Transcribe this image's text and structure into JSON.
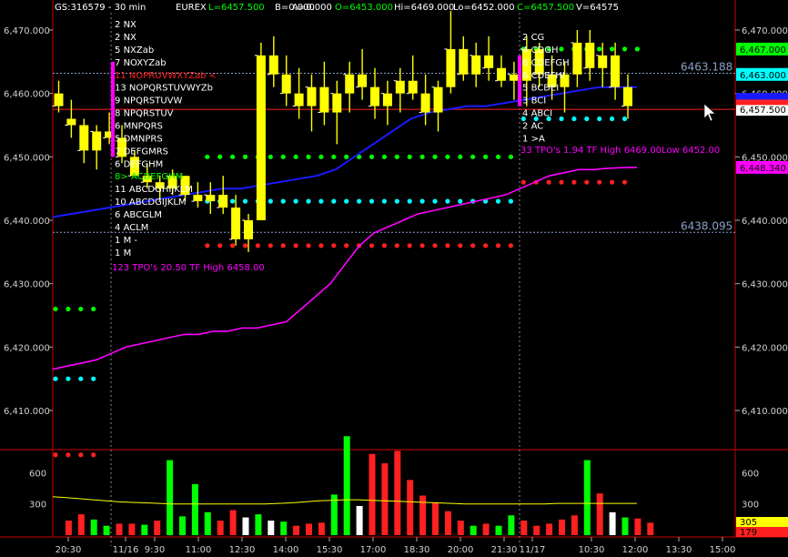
{
  "header": {
    "symbol": "GS:316579 - 30 min",
    "exchange": "EUREX",
    "last": "L=6457.500",
    "bid": "B=0.000",
    "ask": "A=0.000",
    "open": "O=6453.000",
    "high": "Hi=6469.000",
    "low": "Lo=6452.000",
    "close": "C=6457.500",
    "volume": "V=64575"
  },
  "colors": {
    "background": "#000000",
    "bar": "#ffff00",
    "vwap": "#ff00ff",
    "ma": "#1a1aff",
    "dot_green": "#00ff00",
    "dot_cyan": "#00ffff",
    "dot_red": "#ff2020",
    "vol_green": "#00ff00",
    "vol_red": "#ff2020",
    "vol_white": "#ffffff",
    "frame": "#cc0000"
  },
  "chart_data": [
    {
      "type": "bar",
      "subtype": "market-profile-price",
      "ylim": [
        6403,
        6473
      ],
      "yticks": [
        6410,
        6420,
        6430,
        6440,
        6450,
        6460,
        6470
      ],
      "ytick_labels": [
        "6,410.000",
        "6,420.000",
        "6,430.000",
        "6,440.000",
        "6,450.000",
        "6,460.000",
        "6,470.000"
      ],
      "xtick_labels": [
        "20:30",
        "11/16",
        "9:30",
        "11:00",
        "12:30",
        "14:00",
        "15:30",
        "17:00",
        "18:30",
        "20:00",
        "21:30",
        "11/17",
        "10:30",
        "12:00",
        "13:30",
        "15:00"
      ],
      "reference_lines": [
        {
          "value": 6463.188,
          "label": "6463.188"
        },
        {
          "value": 6438.095,
          "label": "6438.095"
        }
      ],
      "current_price": 6457.5,
      "right_labels": [
        {
          "value": 6467.0,
          "label": "6,467.000",
          "color": "#00ff00"
        },
        {
          "value": 6463.0,
          "label": "6,463.000",
          "color": "#00ffff"
        },
        {
          "value": 6457.5,
          "label": "6,457.500",
          "color": "#ffffff"
        },
        {
          "value": 6448.34,
          "label": "6,448.340",
          "color": "#ff00ff"
        }
      ],
      "profile_left": {
        "rows": [
          {
            "price": 6471.0,
            "count": "2",
            "letters": "NX"
          },
          {
            "price": 6469.0,
            "count": "2",
            "letters": "NX"
          },
          {
            "price": 6467.0,
            "count": "5",
            "letters": "NXZab"
          },
          {
            "price": 6465.0,
            "count": "7",
            "letters": "NOXYZab"
          },
          {
            "price": 6463.0,
            "count": "11",
            "letters": "NOPRUVWXYZab <"
          },
          {
            "price": 6461.0,
            "count": "13",
            "letters": "NOPQRSTUVWYZb"
          },
          {
            "price": 6459.0,
            "count": "9",
            "letters": "NPQRSTUVW"
          },
          {
            "price": 6457.0,
            "count": "8",
            "letters": "NPQRSTUV"
          },
          {
            "price": 6455.0,
            "count": "6",
            "letters": "MNPQRS"
          },
          {
            "price": 6453.0,
            "count": "5",
            "letters": "DMNPRS"
          },
          {
            "price": 6451.0,
            "count": "7",
            "letters": "DEFGMRS"
          },
          {
            "price": 6449.0,
            "count": "6",
            "letters": "DEFGHM"
          },
          {
            "price": 6447.0,
            "count": "8>",
            "letters": "ACDEFGHM"
          },
          {
            "price": 6445.0,
            "count": "11",
            "letters": "ABCDGHIJKLM"
          },
          {
            "price": 6443.0,
            "count": "10",
            "letters": "ABCDGIJKLM"
          },
          {
            "price": 6441.0,
            "count": "6",
            "letters": "ABCGLM"
          },
          {
            "price": 6439.0,
            "count": "4",
            "letters": "ACLM"
          },
          {
            "price": 6437.0,
            "count": "1",
            "letters": "M -"
          },
          {
            "price": 6435.0,
            "count": "1",
            "letters": "M"
          }
        ],
        "summary": "123 TPO's 20.50 TF High 6458.00"
      },
      "profile_right": {
        "rows": [
          {
            "price": 6469.0,
            "count": "2",
            "letters": "CG"
          },
          {
            "price": 6467.0,
            "count": "4",
            "letters": "CDGH"
          },
          {
            "price": 6465.0,
            "count": "6",
            "letters": "CDEFGH"
          },
          {
            "price": 6463.0,
            "count": "6",
            "letters": "CDEFHI"
          },
          {
            "price": 6461.0,
            "count": "5",
            "letters": "BCDEI"
          },
          {
            "price": 6459.0,
            "count": "3",
            "letters": "BCI"
          },
          {
            "price": 6457.0,
            "count": "4",
            "letters": "ABCI"
          },
          {
            "price": 6455.0,
            "count": "2",
            "letters": "AC"
          },
          {
            "price": 6453.0,
            "count": "1",
            "letters": ">A"
          }
        ],
        "summary": "33 TPO's 1.94 TF High 6469.00Low 6452.00"
      },
      "dot_levels": [
        {
          "value": 6426,
          "color": "green",
          "range": [
            0,
            3
          ]
        },
        {
          "value": 6415,
          "color": "cyan",
          "range": [
            0,
            3
          ]
        },
        {
          "value": 6403,
          "color": "red",
          "range": [
            0,
            3
          ]
        },
        {
          "value": 6450,
          "color": "green",
          "range": [
            12,
            36
          ]
        },
        {
          "value": 6443,
          "color": "cyan",
          "range": [
            12,
            36
          ]
        },
        {
          "value": 6436,
          "color": "red",
          "range": [
            12,
            36
          ]
        },
        {
          "value": 6467,
          "color": "green",
          "range": [
            37,
            46
          ]
        },
        {
          "value": 6456,
          "color": "cyan",
          "range": [
            37,
            45
          ]
        },
        {
          "value": 6446,
          "color": "red",
          "range": [
            37,
            45
          ]
        }
      ],
      "bars_x": [
        0,
        1,
        2,
        3,
        4,
        5,
        6,
        7,
        8,
        9,
        10,
        11,
        12,
        13,
        14,
        15,
        16,
        17,
        18,
        19,
        20,
        21,
        22,
        23,
        24,
        25,
        26,
        27,
        28,
        29,
        30,
        31,
        32,
        33,
        34,
        35,
        36,
        37,
        38,
        39,
        40,
        41,
        42,
        43,
        44,
        45,
        46,
        47,
        48,
        49,
        50
      ],
      "ohlc": [
        [
          6460,
          6462,
          6457,
          6458
        ],
        [
          6456,
          6459,
          6453,
          6455
        ],
        [
          6455,
          6456,
          6449,
          6451
        ],
        [
          6451,
          6455,
          6448,
          6454
        ],
        [
          6454,
          6457,
          6452,
          6453
        ],
        [
          6453,
          6455,
          6449,
          6450
        ],
        [
          6450,
          6451,
          6447,
          6447
        ],
        [
          6447,
          6449,
          6445,
          6446
        ],
        [
          6446,
          6447,
          6443,
          6445
        ],
        [
          6445,
          6448,
          6444,
          6447
        ],
        [
          6447,
          6447,
          6443,
          6444
        ],
        [
          6444,
          6446,
          6442,
          6443
        ],
        [
          6443,
          6446,
          6441,
          6444
        ],
        [
          6444,
          6447,
          6441,
          6442
        ],
        [
          6442,
          6444,
          6436,
          6437
        ],
        [
          6437,
          6441,
          6435,
          6440
        ],
        [
          6440,
          6468,
          6440,
          6466
        ],
        [
          6466,
          6469,
          6461,
          6463
        ],
        [
          6463,
          6466,
          6458,
          6460
        ],
        [
          6460,
          6464,
          6456,
          6458
        ],
        [
          6458,
          6463,
          6454,
          6461
        ],
        [
          6461,
          6465,
          6455,
          6457
        ],
        [
          6457,
          6462,
          6452,
          6460
        ],
        [
          6460,
          6465,
          6457,
          6463
        ],
        [
          6463,
          6467,
          6459,
          6461
        ],
        [
          6461,
          6464,
          6456,
          6458
        ],
        [
          6458,
          6462,
          6455,
          6460
        ],
        [
          6460,
          6464,
          6457,
          6462
        ],
        [
          6462,
          6466,
          6459,
          6460
        ],
        [
          6460,
          6463,
          6455,
          6457
        ],
        [
          6457,
          6462,
          6454,
          6461
        ],
        [
          6461,
          6473,
          6460,
          6467
        ],
        [
          6467,
          6469,
          6462,
          6463
        ],
        [
          6463,
          6468,
          6461,
          6466
        ],
        [
          6466,
          6469,
          6462,
          6464
        ],
        [
          6464,
          6466,
          6461,
          6462
        ],
        [
          6462,
          6465,
          6459,
          6463
        ],
        [
          6462,
          6469,
          6458,
          6467
        ],
        [
          6467,
          6468,
          6461,
          6463
        ],
        [
          6463,
          6466,
          6459,
          6461
        ],
        [
          6461,
          6465,
          6457,
          6463
        ],
        [
          6463,
          6470,
          6461,
          6468
        ],
        [
          6468,
          6470,
          6462,
          6464
        ],
        [
          6464,
          6468,
          6461,
          6466
        ],
        [
          6466,
          6468,
          6459,
          6461
        ],
        [
          6461,
          6463,
          6456,
          6458
        ]
      ],
      "vwap": [
        6416.5,
        6417,
        6417.5,
        6418,
        6419,
        6420,
        6420.5,
        6421,
        6421.5,
        6422,
        6422,
        6422.5,
        6422.5,
        6423,
        6423,
        6423.5,
        6424,
        6426,
        6428,
        6430,
        6433,
        6436,
        6438,
        6439,
        6440,
        6441,
        6441.5,
        6442,
        6442.5,
        6443,
        6443.5,
        6444,
        6445,
        6446,
        6447,
        6447.5,
        6448,
        6448,
        6448.2,
        6448.3,
        6448.34
      ],
      "ma": [
        6440.5,
        6441,
        6441.5,
        6442,
        6442.5,
        6443,
        6443.5,
        6444,
        6444.5,
        6445,
        6445,
        6445.5,
        6446,
        6446.5,
        6447,
        6448,
        6450,
        6452,
        6454,
        6456,
        6457,
        6457.5,
        6458,
        6458,
        6458.5,
        6459,
        6459.5,
        6460,
        6460.5,
        6461,
        6461,
        6461
      ],
      "ma_x_offset": 0
    },
    {
      "type": "bar",
      "subtype": "volume",
      "ylim": [
        0,
        900
      ],
      "yticks": [
        300,
        600
      ],
      "ytick_labels": [
        "300",
        "600"
      ],
      "right_labels": [
        {
          "label": "305",
          "color": "#ffff00"
        },
        {
          "label": "179",
          "color": "#ff2020"
        }
      ],
      "avg_line": [
        370,
        360,
        350,
        340,
        330,
        320,
        315,
        310,
        305,
        300,
        300,
        300,
        300,
        300,
        300,
        300,
        300,
        305,
        310,
        320,
        330,
        335,
        340,
        340,
        335,
        330,
        325,
        320,
        315,
        310,
        305,
        300,
        300,
        300,
        300,
        300,
        300,
        300,
        305,
        305,
        305,
        305,
        305,
        305,
        305
      ],
      "values": [
        {
          "x": 1,
          "v": 140,
          "c": "red"
        },
        {
          "x": 2,
          "v": 200,
          "c": "red"
        },
        {
          "x": 3,
          "v": 150,
          "c": "green"
        },
        {
          "x": 4,
          "v": 90,
          "c": "green"
        },
        {
          "x": 5,
          "v": 110,
          "c": "red"
        },
        {
          "x": 6,
          "v": 110,
          "c": "red"
        },
        {
          "x": 7,
          "v": 100,
          "c": "green"
        },
        {
          "x": 8,
          "v": 140,
          "c": "red"
        },
        {
          "x": 9,
          "v": 720,
          "c": "green"
        },
        {
          "x": 10,
          "v": 180,
          "c": "green"
        },
        {
          "x": 11,
          "v": 490,
          "c": "green"
        },
        {
          "x": 12,
          "v": 220,
          "c": "green"
        },
        {
          "x": 13,
          "v": 140,
          "c": "red"
        },
        {
          "x": 14,
          "v": 240,
          "c": "red"
        },
        {
          "x": 15,
          "v": 170,
          "c": "white"
        },
        {
          "x": 16,
          "v": 200,
          "c": "green"
        },
        {
          "x": 17,
          "v": 140,
          "c": "white"
        },
        {
          "x": 18,
          "v": 130,
          "c": "green"
        },
        {
          "x": 19,
          "v": 90,
          "c": "red"
        },
        {
          "x": 20,
          "v": 110,
          "c": "red"
        },
        {
          "x": 21,
          "v": 120,
          "c": "red"
        },
        {
          "x": 22,
          "v": 390,
          "c": "green"
        },
        {
          "x": 23,
          "v": 950,
          "c": "green"
        },
        {
          "x": 24,
          "v": 280,
          "c": "white"
        },
        {
          "x": 25,
          "v": 780,
          "c": "red"
        },
        {
          "x": 26,
          "v": 690,
          "c": "red"
        },
        {
          "x": 27,
          "v": 810,
          "c": "red"
        },
        {
          "x": 28,
          "v": 530,
          "c": "red"
        },
        {
          "x": 29,
          "v": 380,
          "c": "red"
        },
        {
          "x": 30,
          "v": 310,
          "c": "red"
        },
        {
          "x": 31,
          "v": 230,
          "c": "red"
        },
        {
          "x": 32,
          "v": 140,
          "c": "red"
        },
        {
          "x": 33,
          "v": 90,
          "c": "green"
        },
        {
          "x": 34,
          "v": 110,
          "c": "red"
        },
        {
          "x": 35,
          "v": 90,
          "c": "green"
        },
        {
          "x": 36,
          "v": 190,
          "c": "green"
        },
        {
          "x": 37,
          "v": 140,
          "c": "red"
        },
        {
          "x": 38,
          "v": 90,
          "c": "red"
        },
        {
          "x": 39,
          "v": 110,
          "c": "red"
        },
        {
          "x": 40,
          "v": 150,
          "c": "red"
        },
        {
          "x": 41,
          "v": 190,
          "c": "red"
        },
        {
          "x": 42,
          "v": 720,
          "c": "green"
        },
        {
          "x": 43,
          "v": 400,
          "c": "red"
        },
        {
          "x": 44,
          "v": 220,
          "c": "white"
        },
        {
          "x": 45,
          "v": 170,
          "c": "green"
        },
        {
          "x": 46,
          "v": 160,
          "c": "red"
        },
        {
          "x": 47,
          "v": 120,
          "c": "red"
        }
      ]
    }
  ]
}
